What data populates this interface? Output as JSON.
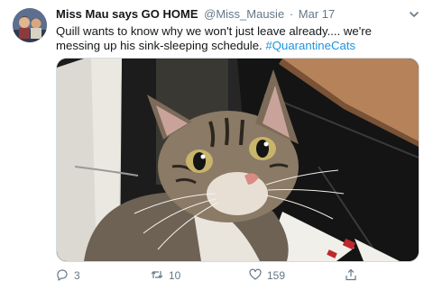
{
  "tweet": {
    "display_name": "Miss Mau says GO HOME",
    "handle": "@Miss_Mausie",
    "separator": "·",
    "date": "Mar 17",
    "text": "Quill wants to know why we won't just leave already.... we're messing up his sink-sleeping schedule.",
    "hashtag": "#QuarantineCats",
    "media": {
      "alt": "Tabby cat looking up at camera"
    },
    "actions": {
      "reply": {
        "icon": "reply-icon",
        "count": "3"
      },
      "retweet": {
        "icon": "retweet-icon",
        "count": "10"
      },
      "like": {
        "icon": "heart-icon",
        "count": "159"
      },
      "share": {
        "icon": "share-icon",
        "count": ""
      }
    }
  },
  "colors": {
    "text": "#14171a",
    "secondary": "#657786",
    "link": "#1b95e0"
  }
}
